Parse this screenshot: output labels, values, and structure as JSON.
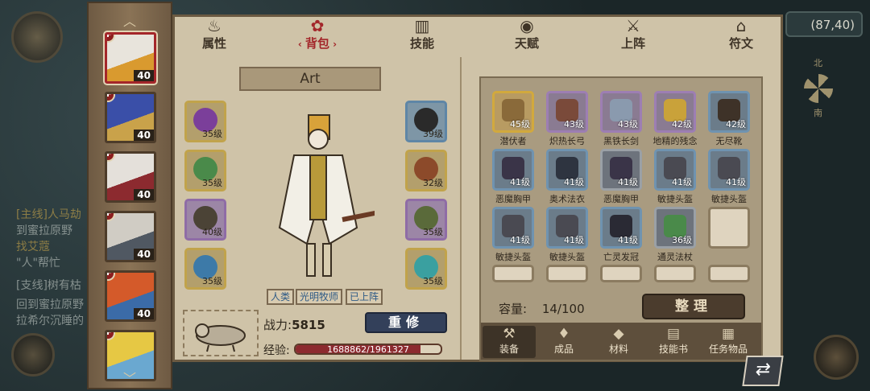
{
  "coord_display": "(87,40)",
  "compass": {
    "north": "北",
    "south": "南"
  },
  "background_quests": [
    {
      "text": "[主线]人马劫",
      "quest": true
    },
    {
      "text": "到蜜拉原野",
      "quest": false
    },
    {
      "text": "找艾蔻",
      "quest": true
    },
    {
      "text": "\"人\"帮忙",
      "quest": false
    },
    {
      "text": "[支线]树有枯",
      "quest": false
    },
    {
      "text": "回到蜜拉原野",
      "quest": false
    },
    {
      "text": "拉希尔沉睡的",
      "quest": false
    }
  ],
  "heroes": [
    {
      "level": "40",
      "active": true,
      "colors": [
        "#e8e4dc",
        "#d99a2f"
      ]
    },
    {
      "level": "40",
      "active": false,
      "colors": [
        "#3a4fa8",
        "#c9a24a"
      ]
    },
    {
      "level": "40",
      "active": false,
      "colors": [
        "#e4e0da",
        "#8c2a2f"
      ]
    },
    {
      "level": "40",
      "active": false,
      "colors": [
        "#d0ccc4",
        "#505862"
      ]
    },
    {
      "level": "40",
      "active": false,
      "colors": [
        "#d45a2a",
        "#3b6ba8"
      ]
    },
    {
      "level": "",
      "active": false,
      "colors": [
        "#e6c844",
        "#6aa8d0"
      ]
    }
  ],
  "tabs": [
    {
      "label": "属性",
      "icon": "flame-icon",
      "glyph": "♨",
      "active": false
    },
    {
      "label": "背包",
      "icon": "rose-icon",
      "glyph": "✿",
      "active": true
    },
    {
      "label": "技能",
      "icon": "book-icon",
      "glyph": "▥",
      "active": false
    },
    {
      "label": "天赋",
      "icon": "eye-icon",
      "glyph": "◉",
      "active": false
    },
    {
      "label": "上阵",
      "icon": "crossed-swords-icon",
      "glyph": "⚔",
      "active": false
    },
    {
      "label": "符文",
      "icon": "house-icon",
      "glyph": "⌂",
      "active": false
    }
  ],
  "character": {
    "name": "Art",
    "tags": [
      "人类",
      "光明牧师",
      "已上阵"
    ],
    "power_label": "战力:",
    "power_value": "5815",
    "refine_label": "重修",
    "exp_label": "经验:",
    "exp_text": "1688862/1961327",
    "exp_fraction": 0.861
  },
  "equipped_left": [
    {
      "level": "35级",
      "rarity": "gold",
      "color": "#7b3f9a"
    },
    {
      "level": "35级",
      "rarity": "gold",
      "color": "#4a8a4a"
    },
    {
      "level": "40级",
      "rarity": "purple",
      "color": "#4b4336"
    },
    {
      "level": "35级",
      "rarity": "gold",
      "color": "#3d7aa8"
    }
  ],
  "equipped_right": [
    {
      "level": "39级",
      "rarity": "blue",
      "color": "#2a2a2a"
    },
    {
      "level": "32级",
      "rarity": "gold",
      "color": "#8c4a2a"
    },
    {
      "level": "35级",
      "rarity": "purple",
      "color": "#5a6a3a"
    },
    {
      "level": "35级",
      "rarity": "gold",
      "color": "#3aa0a0"
    }
  ],
  "inventory": {
    "items": [
      {
        "name": "潜伏者",
        "level": "45级",
        "rarity": "gold",
        "color": "#8a6a3a"
      },
      {
        "name": "炽热长弓",
        "level": "43级",
        "rarity": "purple",
        "color": "#7a4a3a"
      },
      {
        "name": "黑铁长剑",
        "level": "43级",
        "rarity": "purple",
        "color": "#8a9aae"
      },
      {
        "name": "地精的残念",
        "level": "42级",
        "rarity": "purple",
        "color": "#c9a23a"
      },
      {
        "name": "无尽靴",
        "level": "42级",
        "rarity": "blue",
        "color": "#3e3228"
      },
      {
        "name": "恶魔胸甲",
        "level": "41级",
        "rarity": "blue",
        "color": "#3a3448"
      },
      {
        "name": "奥术法衣",
        "level": "41级",
        "rarity": "blue",
        "color": "#2e3440"
      },
      {
        "name": "恶魔胸甲",
        "level": "41级",
        "rarity": "gray",
        "color": "#3a3448"
      },
      {
        "name": "敏捷头盔",
        "level": "41级",
        "rarity": "blue",
        "color": "#4a4a52"
      },
      {
        "name": "敏捷头盔",
        "level": "41级",
        "rarity": "blue",
        "color": "#4a4a52"
      },
      {
        "name": "敏捷头盔",
        "level": "41级",
        "rarity": "blue",
        "color": "#4a4a52"
      },
      {
        "name": "敏捷头盔",
        "level": "41级",
        "rarity": "blue",
        "color": "#4a4a52"
      },
      {
        "name": "亡灵发冠",
        "level": "41级",
        "rarity": "blue",
        "color": "#2a2a34"
      },
      {
        "name": "通灵法杖",
        "level": "36级",
        "rarity": "gray",
        "color": "#4a8a4a"
      },
      {
        "name": "",
        "level": "",
        "rarity": "empty",
        "color": ""
      },
      {
        "name": "",
        "level": "",
        "rarity": "empty",
        "color": ""
      },
      {
        "name": "",
        "level": "",
        "rarity": "empty",
        "color": ""
      },
      {
        "name": "",
        "level": "",
        "rarity": "empty",
        "color": ""
      },
      {
        "name": "",
        "level": "",
        "rarity": "empty",
        "color": ""
      },
      {
        "name": "",
        "level": "",
        "rarity": "empty",
        "color": ""
      }
    ],
    "capacity_label": "容量:",
    "capacity_value": "14/100",
    "sort_label": "整理"
  },
  "categories": [
    {
      "label": "装备",
      "icon": "hammer-icon",
      "glyph": "⚒",
      "active": true
    },
    {
      "label": "成品",
      "icon": "bag-icon",
      "glyph": "♦",
      "active": false
    },
    {
      "label": "材料",
      "icon": "ore-icon",
      "glyph": "◆",
      "active": false
    },
    {
      "label": "技能书",
      "icon": "scroll-icon",
      "glyph": "▤",
      "active": false
    },
    {
      "label": "任务物品",
      "icon": "quest-scroll-icon",
      "glyph": "▦",
      "active": false
    }
  ],
  "colors": {
    "accent": "#a3262a",
    "panel": "#cfc3a8",
    "button_dark": "#33405a"
  }
}
